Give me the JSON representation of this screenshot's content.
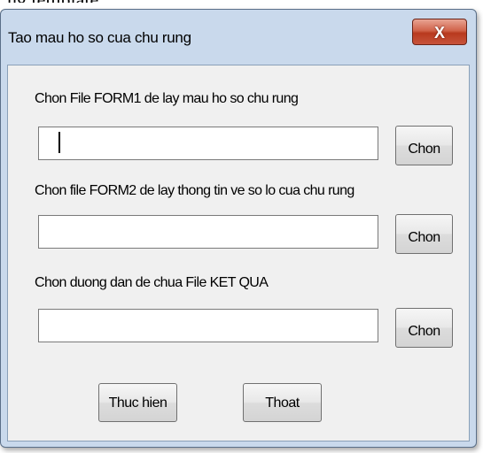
{
  "window": {
    "title": "Tao mau ho so cua chu rung",
    "close_label": "X"
  },
  "groups": [
    {
      "label": "Chon File FORM1 de lay mau ho so chu rung",
      "value": "",
      "button_label": "Chon"
    },
    {
      "label": "Chon file FORM2 de lay thong tin ve so lo cua chu rung",
      "value": "",
      "button_label": "Chon"
    },
    {
      "label": "Chon duong dan de chua File KET QUA",
      "value": "",
      "button_label": "Chon"
    }
  ],
  "actions": {
    "execute_label": "Thuc hien",
    "exit_label": "Thoat"
  },
  "colors": {
    "title_bar": "#c9d9ec",
    "client_bg": "#f0f0f0",
    "close_button": "#c7533b"
  }
}
